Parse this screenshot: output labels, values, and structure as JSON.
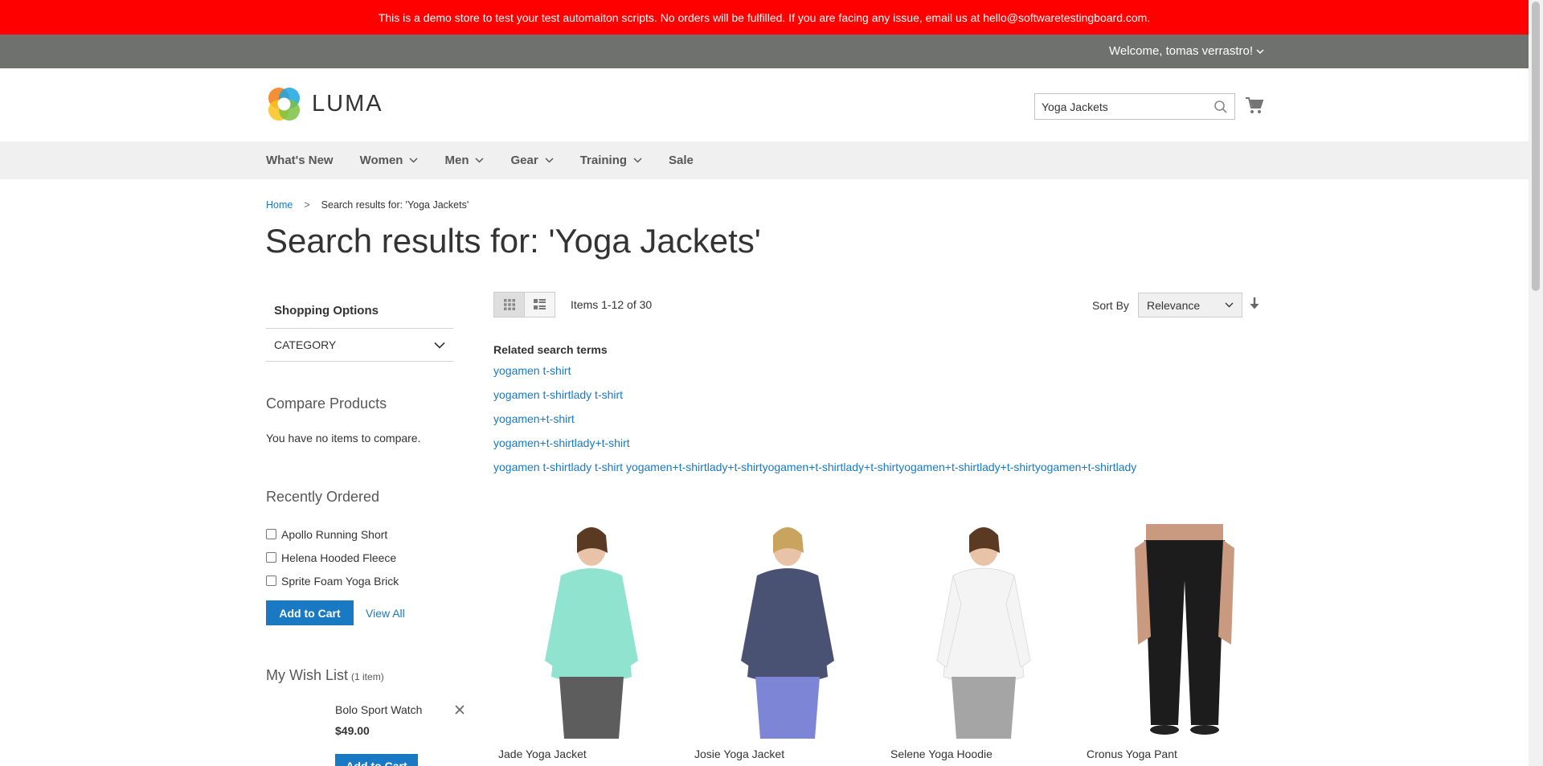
{
  "banner": {
    "text": "This is a demo store to test your test automaiton scripts. No orders will be fulfilled. If you are facing any issue, email us at hello@softwaretestingboard.com."
  },
  "header_panel": {
    "welcome": "Welcome, tomas verrastro!"
  },
  "logo": {
    "text": "LUMA"
  },
  "search": {
    "value": "Yoga Jackets"
  },
  "nav": {
    "items": [
      {
        "label": "What's New",
        "has_dropdown": false
      },
      {
        "label": "Women",
        "has_dropdown": true
      },
      {
        "label": "Men",
        "has_dropdown": true
      },
      {
        "label": "Gear",
        "has_dropdown": true
      },
      {
        "label": "Training",
        "has_dropdown": true
      },
      {
        "label": "Sale",
        "has_dropdown": false
      }
    ]
  },
  "breadcrumb": {
    "home": "Home",
    "separator": ">",
    "current": "Search results for: 'Yoga Jackets'"
  },
  "page_title": "Search results for: 'Yoga Jackets'",
  "sidebar": {
    "shopping_options": "Shopping Options",
    "category_filter": "CATEGORY",
    "compare_title": "Compare Products",
    "compare_empty": "You have no items to compare.",
    "recent_title": "Recently Ordered",
    "recent_items": [
      "Apollo Running Short",
      "Helena Hooded Fleece",
      "Sprite Foam Yoga Brick"
    ],
    "recent_add_to_cart": "Add to Cart",
    "recent_view_all": "View All",
    "wishlist_title": "My Wish List",
    "wishlist_count": "(1 item)",
    "wishlist_item": {
      "name": "Bolo Sport Watch",
      "price": "$49.00",
      "add_to_cart": "Add to Cart"
    }
  },
  "toolbar": {
    "items_count": "Items 1-12 of 30",
    "sort_label": "Sort By",
    "sort_value": "Relevance"
  },
  "related": {
    "title": "Related search terms",
    "terms": [
      "yogamen t-shirt",
      "yogamen t-shirtlady t-shirt",
      "yogamen+t-shirt",
      "yogamen+t-shirtlady+t-shirt",
      "yogamen t-shirtlady t-shirt yogamen+t-shirtlady+t-shirtyogamen+t-shirtlady+t-shirtyogamen+t-shirtlady+t-shirtyogamen+t-shirtlady"
    ]
  },
  "products": [
    {
      "name": "Jade Yoga Jacket",
      "color": "#8fe3cf"
    },
    {
      "name": "Josie Yoga Jacket",
      "color": "#4a5273"
    },
    {
      "name": "Selene Yoga Hoodie",
      "color": "#f4f4f4"
    },
    {
      "name": "Cronus Yoga Pant",
      "color": "#1c1c1c"
    }
  ],
  "colors": {
    "banner": "#ff0000",
    "panel": "#6e716e",
    "link": "#1979c3",
    "nav_bg": "#f0f0f0"
  }
}
